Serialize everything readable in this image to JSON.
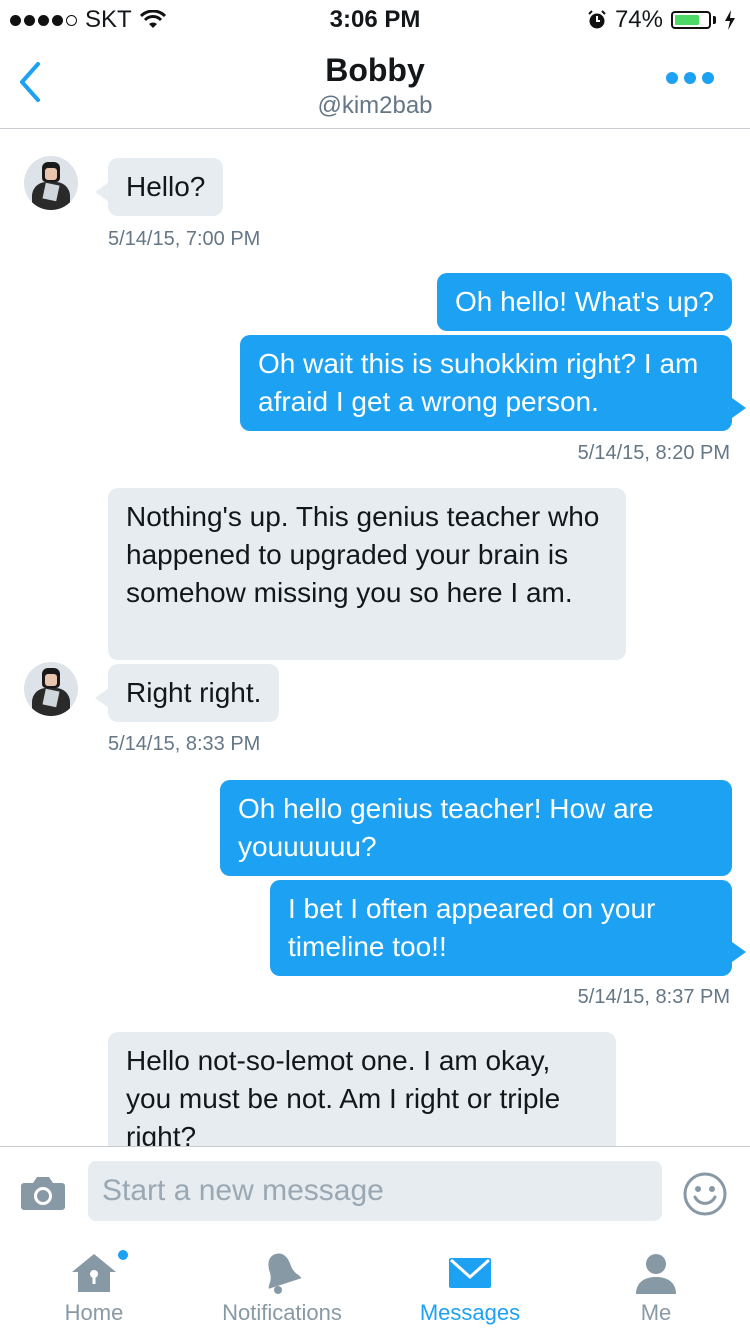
{
  "status_bar": {
    "carrier": "SKT",
    "time": "3:06 PM",
    "battery": "74%",
    "battery_level": 0.74
  },
  "header": {
    "title": "Bobby",
    "subtitle": "@kim2bab"
  },
  "messages": [
    {
      "direction": "in",
      "text": "Hello?"
    },
    {
      "timestamp": "5/14/15, 7:00 PM"
    },
    {
      "direction": "out",
      "text": "Oh hello! What's up?"
    },
    {
      "direction": "out",
      "text": "Oh wait this is suhokkim right? I am afraid I get a wrong person."
    },
    {
      "timestamp": "5/14/15, 8:20 PM"
    },
    {
      "direction": "in",
      "text": "Nothing's up. This genius teacher who happened to upgraded your brain is somehow missing you so here I am."
    },
    {
      "direction": "in",
      "text": "Right right."
    },
    {
      "timestamp": "5/14/15, 8:33 PM"
    },
    {
      "direction": "out",
      "text": "Oh hello genius teacher! How are youuuuuu?"
    },
    {
      "direction": "out",
      "text": "I bet I often appeared on your timeline too!!"
    },
    {
      "timestamp": "5/14/15, 8:37 PM"
    },
    {
      "direction": "in",
      "text": "Hello not-so-lemot one. I am okay, you must be not. Am I right or triple right?"
    }
  ],
  "composer": {
    "placeholder": "Start a new message"
  },
  "tabs": [
    {
      "label": "Home",
      "icon": "home-icon",
      "has_badge": true
    },
    {
      "label": "Notifications",
      "icon": "bell-icon"
    },
    {
      "label": "Messages",
      "icon": "envelope-icon",
      "active": true
    },
    {
      "label": "Me",
      "icon": "person-icon"
    }
  ],
  "colors": {
    "accent": "#1da1f2",
    "incoming_bubble": "#e6ecf0",
    "muted_text": "#657786",
    "battery_fill": "#4cd964"
  }
}
